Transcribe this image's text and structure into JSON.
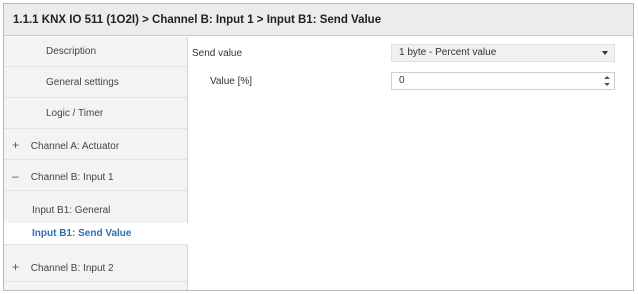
{
  "window": {
    "breadcrumb": "1.1.1 KNX IO 511 (1O2I) > Channel B: Input 1 > Input B1: Send Value"
  },
  "sidebar": {
    "items": [
      {
        "label": "Description"
      },
      {
        "label": "General settings"
      },
      {
        "label": "Logic / Timer"
      },
      {
        "label": "Channel A: Actuator",
        "mark": "+"
      },
      {
        "label": "Channel B: Input 1",
        "mark": "–"
      },
      {
        "label": "Input B1: General"
      },
      {
        "label": "Input B1: Send Value"
      },
      {
        "label": "Channel B: Input 2",
        "mark": "+"
      }
    ]
  },
  "main": {
    "send_value_label": "Send value",
    "send_value_selected": "1 byte - Percent value",
    "value_label": "Value [%]",
    "value_current": "0"
  },
  "colors": {
    "active_text": "#2f6fb0",
    "sidebar_bg": "#f3f3f3",
    "titlebar_bg": "#ececec"
  },
  "icons": {
    "expand": "plus-icon",
    "collapse": "minus-icon",
    "dropdown": "chevron-down-icon",
    "spinner": "spinner-arrows-icon"
  }
}
